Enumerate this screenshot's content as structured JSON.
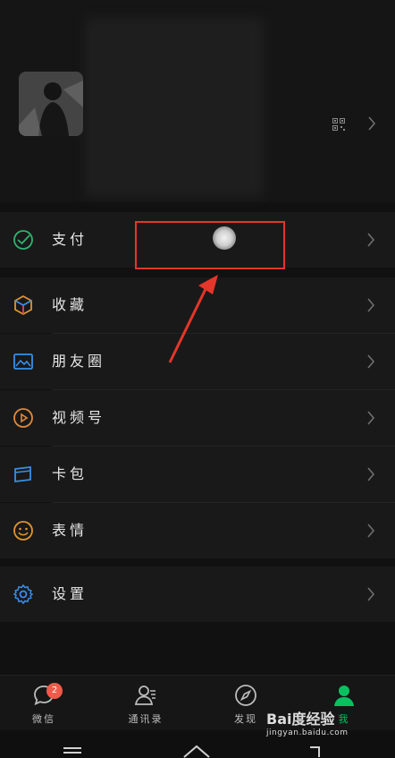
{
  "menu": {
    "pay": "支付",
    "favorites": "收藏",
    "moments": "朋友圈",
    "channels": "视频号",
    "cards": "卡包",
    "stickers": "表情",
    "settings": "设置"
  },
  "tabs": {
    "chats": "微信",
    "contacts": "通讯录",
    "discover": "发现",
    "me": "我"
  },
  "badge": {
    "chats_unread": "2"
  },
  "watermark": {
    "logo": "Bai度经验",
    "url": "jingyan.baidu.com"
  },
  "colors": {
    "accent": "#07c160",
    "highlight": "#e4362a",
    "pay_green": "#2fb36e",
    "favorites_orange": "#e0952f",
    "moments_blue": "#3a8ee6",
    "channels_orange": "#e08a3a",
    "cards_blue": "#3a8ee6",
    "stickers_orange": "#e0952f",
    "settings_blue": "#3a8ee6"
  }
}
